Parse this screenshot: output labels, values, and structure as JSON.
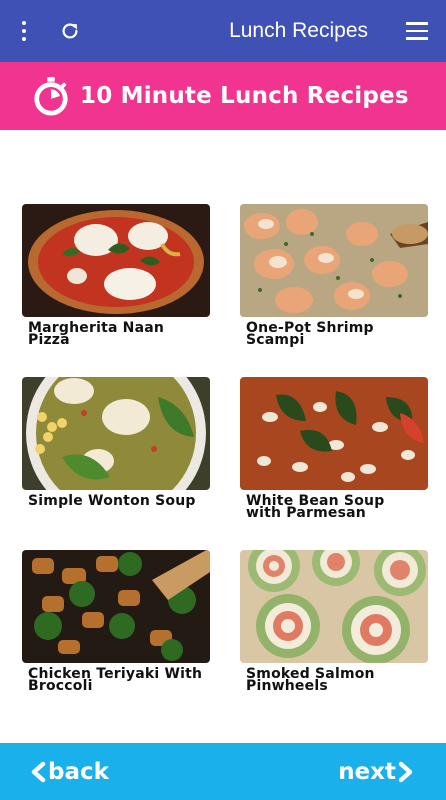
{
  "app_bar": {
    "title": "Lunch Recipes",
    "icons": [
      "more-vert-icon",
      "refresh-icon",
      "hamburger-menu-icon"
    ]
  },
  "banner": {
    "text": "10 Minute Lunch Recipes",
    "icon": "stopwatch-icon"
  },
  "recipes": [
    {
      "name": "Margherita Naan Pizza"
    },
    {
      "name": "One-Pot Shrimp Scampi"
    },
    {
      "name": "Simple Wonton Soup"
    },
    {
      "name": "White Bean Soup with Parmesan"
    },
    {
      "name": "Chicken Teriyaki With Broccoli"
    },
    {
      "name": "Smoked Salmon Pinwheels"
    }
  ],
  "footer": {
    "back_label": "back",
    "next_label": "next"
  },
  "colors": {
    "app_bar": "#3f51b5",
    "banner": "#f0348f",
    "footer": "#1ab0eb"
  }
}
